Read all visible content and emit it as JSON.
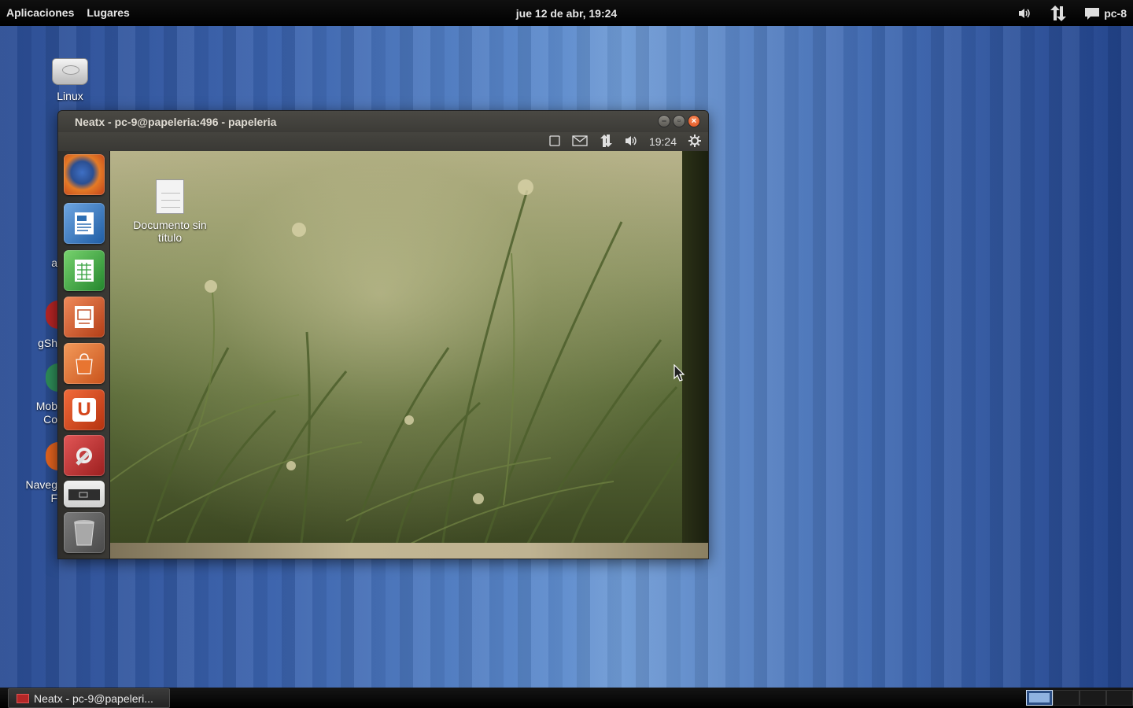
{
  "top_panel": {
    "menus": [
      "Aplicaciones",
      "Lugares"
    ],
    "clock": "jue 12 de abr, 19:24",
    "tray": {
      "volume_icon": "volume-icon",
      "network_icon": "network-transfer-icon",
      "messaging_icon": "messaging-icon",
      "user": "pc-8"
    }
  },
  "desktop": {
    "icons": [
      {
        "label": "Linux",
        "icon": "drive-icon"
      }
    ],
    "partially_hidden_labels": [
      "a",
      "gSh",
      "Mob",
      "Co",
      "Naveg",
      "F"
    ]
  },
  "window": {
    "title": "Neatx - pc-9@papeleria:496 - papeleria",
    "controls": [
      "minimize",
      "maximize",
      "close"
    ],
    "remote_panel": {
      "time": "19:24",
      "icons": [
        "window-icon",
        "mail-icon",
        "network-icon",
        "volume-icon",
        "settings-icon"
      ]
    },
    "launcher": [
      {
        "name": "firefox",
        "color": "#d9631e"
      },
      {
        "name": "writer",
        "color": "#2e6fb4"
      },
      {
        "name": "calc",
        "color": "#34a13d"
      },
      {
        "name": "impress",
        "color": "#c4542b"
      },
      {
        "name": "software-center",
        "color": "#d8632a"
      },
      {
        "name": "ubuntu-one",
        "color": "#d4461c",
        "glyph": "U"
      },
      {
        "name": "system-settings",
        "color": "#c42d2d"
      },
      {
        "name": "workspace-switcher",
        "color": "#3a3a3a"
      },
      {
        "name": "trash",
        "color": "#5a5a5a"
      }
    ],
    "remote_desktop": {
      "doc_icon_label": "Documento sin título"
    }
  },
  "bottom_panel": {
    "task": "Neatx - pc-9@papeleri...",
    "workspaces": 4,
    "active_workspace": 1
  }
}
